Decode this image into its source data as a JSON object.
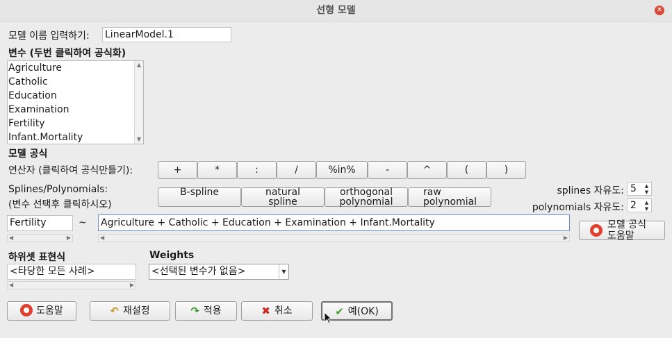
{
  "window": {
    "title": "선형 모델",
    "close_glyph": "✕"
  },
  "model_name": {
    "label": "모델 이름 입력하기:",
    "value": "LinearModel.1"
  },
  "variables": {
    "heading": "변수 (두번 클릭하여 공식화)",
    "items": [
      "Agriculture",
      "Catholic",
      "Education",
      "Examination",
      "Fertility",
      "Infant.Mortality"
    ]
  },
  "formula_section": {
    "heading": "모델 공식",
    "operators_label": "연산자 (클릭하여 공식만들기):",
    "operators": [
      "+",
      "*",
      ":",
      "/",
      "%in%",
      "-",
      "^",
      "(",
      ")"
    ],
    "splines_label_1": "Splines/Polynomials:",
    "splines_label_2": "(변수 선택후 클릭하시오)",
    "spline_buttons": [
      {
        "line1": "B-spline",
        "line2": ""
      },
      {
        "line1": "natural",
        "line2": "spline"
      },
      {
        "line1": "orthogonal",
        "line2": "polynomial"
      },
      {
        "line1": "raw",
        "line2": "polynomial"
      }
    ],
    "splines_df_label": "splines 자유도:",
    "splines_df_value": "5",
    "poly_df_label": "polynomials 자유도:",
    "poly_df_value": "2",
    "lhs_value": "Fertility",
    "tilde": "~",
    "rhs_value": "Agriculture + Catholic + Education + Examination + Infant.Mortality",
    "formula_help_line1": "모델 공식",
    "formula_help_line2": "도움말"
  },
  "subset": {
    "heading": "하위셋 표현식",
    "value": "<타당한 모든 사례>"
  },
  "weights": {
    "heading": "Weights",
    "selected": "<선택된 변수가 없음>"
  },
  "buttons": {
    "help": "도움말",
    "reset": "재설정",
    "apply": "적용",
    "cancel": "취소",
    "ok": "예(OK)"
  },
  "icons": {
    "help": "lifebuoy-icon",
    "reset": "undo-arrow-icon",
    "apply": "redo-arrow-icon",
    "cancel": "red-x-icon",
    "ok": "green-check-icon"
  }
}
